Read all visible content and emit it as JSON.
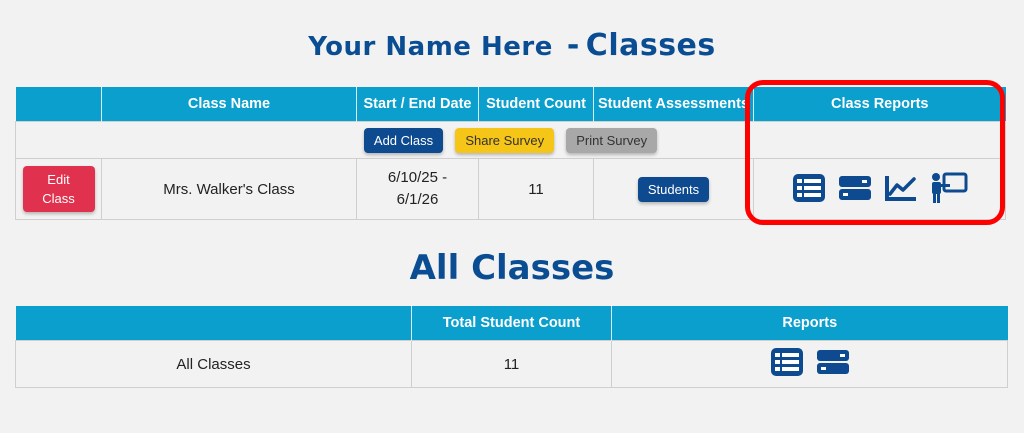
{
  "title": {
    "name": "Your Name Here",
    "separator": "-",
    "suffix": "Classes"
  },
  "classes_table": {
    "headers": [
      "",
      "Class Name",
      "Start / End Date",
      "Student Count",
      "Student Assessments",
      "Class Reports"
    ],
    "actions": {
      "add": "Add Class",
      "share": "Share Survey",
      "print": "Print Survey"
    },
    "rows": [
      {
        "edit_label": "Edit Class",
        "class_name": "Mrs. Walker's Class",
        "start_date": "6/10/25 -",
        "end_date": "6/1/26",
        "student_count": "11",
        "assessments_button": "Students",
        "report_icons": [
          "list-report-icon",
          "summary-report-icon",
          "chart-report-icon",
          "presenter-report-icon"
        ]
      }
    ]
  },
  "all_classes": {
    "title": "All Classes",
    "headers": [
      "",
      "Total Student Count",
      "Reports"
    ],
    "row": {
      "label": "All Classes",
      "count": "11",
      "report_icons": [
        "list-report-icon",
        "summary-report-icon"
      ]
    }
  },
  "colors": {
    "accent": "#0b9fcd",
    "navy": "#0d4a8f",
    "red": "#e0324f",
    "yellow": "#f5c518",
    "highlight": "#ff0000"
  }
}
